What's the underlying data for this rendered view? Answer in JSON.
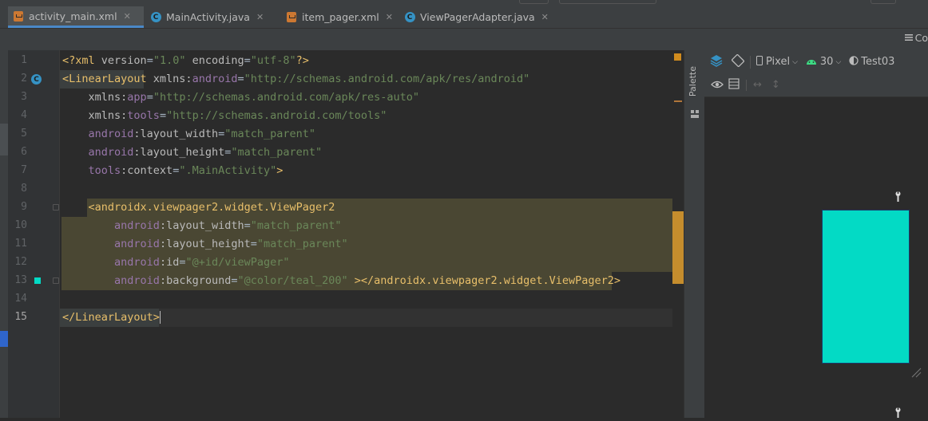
{
  "tabs": [
    {
      "label": "activity_main.xml",
      "icon": "xml-file-icon",
      "active": true
    },
    {
      "label": "MainActivity.java",
      "icon": "class-icon",
      "active": false
    },
    {
      "label": "item_pager.xml",
      "icon": "xml-file-icon",
      "active": false
    },
    {
      "label": "ViewPagerAdapter.java",
      "icon": "class-icon",
      "active": false
    }
  ],
  "code_mode_label": "Co",
  "palette_label": "Palette",
  "design_toolbar": {
    "device": "Pixel",
    "api": "30",
    "theme": "Test03"
  },
  "line_numbers": [
    "1",
    "2",
    "3",
    "4",
    "5",
    "6",
    "7",
    "8",
    "9",
    "10",
    "11",
    "12",
    "13",
    "14",
    "15"
  ],
  "code_lines": [
    [
      [
        "pi",
        "<?"
      ],
      [
        "tag",
        "xml "
      ],
      [
        "attr",
        "version"
      ],
      [
        "plain",
        "="
      ],
      [
        "val",
        "\"1.0\""
      ],
      [
        "attr",
        " encoding"
      ],
      [
        "plain",
        "="
      ],
      [
        "val",
        "\"utf-8\""
      ],
      [
        "pi",
        "?>"
      ]
    ],
    [
      [
        "tag",
        "<LinearLayout "
      ],
      [
        "attr",
        "xmlns:"
      ],
      [
        "ns",
        "android"
      ],
      [
        "plain",
        "="
      ],
      [
        "val",
        "\"http://schemas.android.com/apk/res/android\""
      ]
    ],
    [
      [
        "plain",
        "    "
      ],
      [
        "attr",
        "xmlns:"
      ],
      [
        "ns",
        "app"
      ],
      [
        "plain",
        "="
      ],
      [
        "val",
        "\"http://schemas.android.com/apk/res-auto\""
      ]
    ],
    [
      [
        "plain",
        "    "
      ],
      [
        "attr",
        "xmlns:"
      ],
      [
        "ns",
        "tools"
      ],
      [
        "plain",
        "="
      ],
      [
        "val",
        "\"http://schemas.android.com/tools\""
      ]
    ],
    [
      [
        "plain",
        "    "
      ],
      [
        "ns",
        "android"
      ],
      [
        "attr",
        ":layout_width"
      ],
      [
        "plain",
        "="
      ],
      [
        "val",
        "\"match_parent\""
      ]
    ],
    [
      [
        "plain",
        "    "
      ],
      [
        "ns",
        "android"
      ],
      [
        "attr",
        ":layout_height"
      ],
      [
        "plain",
        "="
      ],
      [
        "val",
        "\"match_parent\""
      ]
    ],
    [
      [
        "plain",
        "    "
      ],
      [
        "ns",
        "tools"
      ],
      [
        "attr",
        ":context"
      ],
      [
        "plain",
        "="
      ],
      [
        "val",
        "\".MainActivity\""
      ],
      [
        "tag",
        ">"
      ]
    ],
    [],
    [
      [
        "plain",
        "    "
      ],
      [
        "tag",
        "<androidx.viewpager2.widget.ViewPager2"
      ]
    ],
    [
      [
        "plain",
        "        "
      ],
      [
        "ns",
        "android"
      ],
      [
        "attr",
        ":layout_width"
      ],
      [
        "plain",
        "="
      ],
      [
        "val",
        "\"match_parent\""
      ]
    ],
    [
      [
        "plain",
        "        "
      ],
      [
        "ns",
        "android"
      ],
      [
        "attr",
        ":layout_height"
      ],
      [
        "plain",
        "="
      ],
      [
        "val",
        "\"match_parent\""
      ]
    ],
    [
      [
        "plain",
        "        "
      ],
      [
        "ns",
        "android"
      ],
      [
        "attr",
        ":id"
      ],
      [
        "plain",
        "="
      ],
      [
        "val",
        "\"@+id/viewPager\""
      ]
    ],
    [
      [
        "plain",
        "        "
      ],
      [
        "ns",
        "android"
      ],
      [
        "attr",
        ":background"
      ],
      [
        "plain",
        "="
      ],
      [
        "val",
        "\"@color/teal_200\""
      ],
      [
        "tag",
        " ></androidx.viewpager2.widget.ViewPager2>"
      ]
    ],
    [],
    [
      [
        "tag",
        "</LinearLayout>"
      ]
    ]
  ],
  "colors": {
    "teal_200": "#03dac5",
    "highlight": "#4a4733",
    "accent_blue": "#4a88c7"
  }
}
